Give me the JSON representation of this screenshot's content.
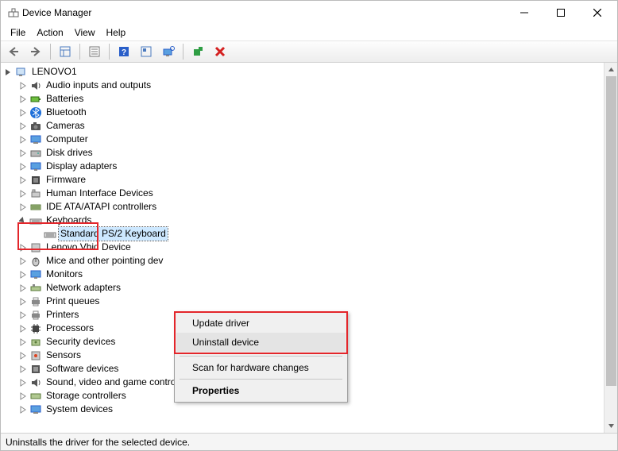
{
  "window": {
    "title": "Device Manager"
  },
  "menu": {
    "file": "File",
    "action": "Action",
    "view": "View",
    "help": "Help"
  },
  "tree": {
    "root": "LENOVO1",
    "items": [
      "Audio inputs and outputs",
      "Batteries",
      "Bluetooth",
      "Cameras",
      "Computer",
      "Disk drives",
      "Display adapters",
      "Firmware",
      "Human Interface Devices",
      "IDE ATA/ATAPI controllers",
      "Keyboards",
      "Lenovo Vhid Device",
      "Mice and other pointing dev",
      "Monitors",
      "Network adapters",
      "Print queues",
      "Printers",
      "Processors",
      "Security devices",
      "Sensors",
      "Software devices",
      "Sound, video and game controllers",
      "Storage controllers",
      "System devices"
    ],
    "keyboards_child": "Standard PS/2 Keyboard"
  },
  "context_menu": {
    "update": "Update driver",
    "uninstall": "Uninstall device",
    "scan": "Scan for hardware changes",
    "properties": "Properties"
  },
  "status": "Uninstalls the driver for the selected device."
}
